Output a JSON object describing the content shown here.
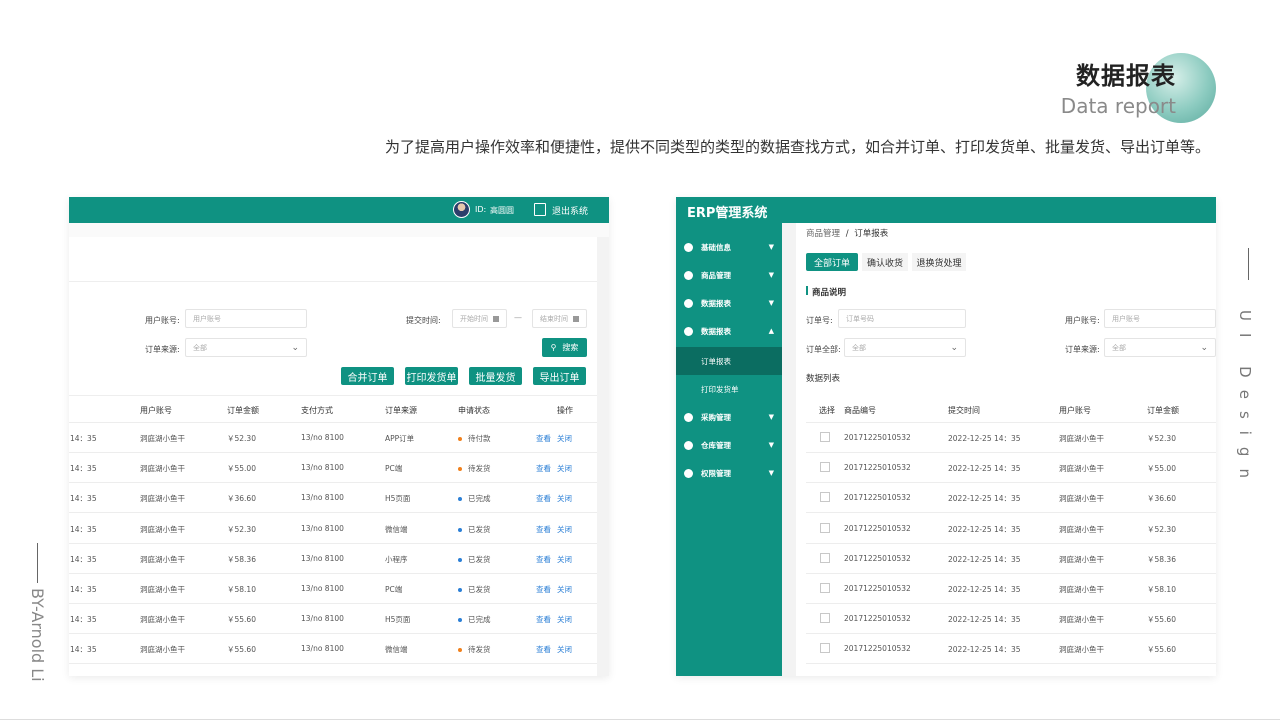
{
  "header": {
    "title_cn": "数据报表",
    "title_en": "Data report",
    "description": "为了提高用户操作效率和便捷性，提供不同类型的类型的数据查找方式，如合并订单、打印发货单、批量发货、导出订单等。"
  },
  "side": {
    "right_vertical": "UI Design",
    "left_vertical": "BY-Arnold Li"
  },
  "left_panel": {
    "user_id_label": "ID:",
    "user_name": "高圆圆",
    "logout_label": "退出系统",
    "filters": {
      "account_label": "用户账号:",
      "account_placeholder": "用户账号",
      "submit_time_label": "提交时间:",
      "start_placeholder": "开始时间",
      "range_sep": "—",
      "end_placeholder": "结束时间",
      "source_label": "订单来源:",
      "source_value": "全部",
      "search_label": "搜索"
    },
    "actions": [
      "合并订单",
      "打印发货单",
      "批量发货",
      "导出订单"
    ],
    "columns": [
      "用户账号",
      "订单金额",
      "支付方式",
      "订单来源",
      "申请状态",
      "操作"
    ],
    "rows": [
      {
        "time": "14：35",
        "account": "洞庭湖小鱼干",
        "amount": "￥52.30",
        "pay": "13/no 8100",
        "source": "APP订单",
        "status": "待付款",
        "status_color": "#f0801c"
      },
      {
        "time": "14：35",
        "account": "洞庭湖小鱼干",
        "amount": "￥55.00",
        "pay": "13/no 8100",
        "source": "PC端",
        "status": "待发货",
        "status_color": "#f0801c"
      },
      {
        "time": "14：35",
        "account": "洞庭湖小鱼干",
        "amount": "￥36.60",
        "pay": "13/no 8100",
        "source": "H5页面",
        "status": "已完成",
        "status_color": "#2b7fd6"
      },
      {
        "time": "14：35",
        "account": "洞庭湖小鱼干",
        "amount": "￥52.30",
        "pay": "13/no 8100",
        "source": "微信端",
        "status": "已发货",
        "status_color": "#2b7fd6"
      },
      {
        "time": "14：35",
        "account": "洞庭湖小鱼干",
        "amount": "￥58.36",
        "pay": "13/no 8100",
        "source": "小程序",
        "status": "已发货",
        "status_color": "#2b7fd6"
      },
      {
        "time": "14：35",
        "account": "洞庭湖小鱼干",
        "amount": "￥58.10",
        "pay": "13/no 8100",
        "source": "PC端",
        "status": "已发货",
        "status_color": "#2b7fd6"
      },
      {
        "time": "14：35",
        "account": "洞庭湖小鱼干",
        "amount": "￥55.60",
        "pay": "13/no 8100",
        "source": "H5页面",
        "status": "已完成",
        "status_color": "#2b7fd6"
      },
      {
        "time": "14：35",
        "account": "洞庭湖小鱼干",
        "amount": "￥55.60",
        "pay": "13/no 8100",
        "source": "微信端",
        "status": "待发货",
        "status_color": "#f0801c"
      }
    ],
    "view_label": "查看",
    "close_label": "关闭"
  },
  "right_panel": {
    "app_title": "ERP管理系统",
    "menu": [
      "基础信息",
      "商品管理",
      "数据报表",
      "数据报表",
      "采购管理",
      "仓库管理",
      "权限管理"
    ],
    "submenu": [
      "订单报表",
      "打印发货单"
    ],
    "breadcrumb": {
      "parent": "商品管理",
      "sep": "/",
      "current": "订单报表"
    },
    "tabs": [
      "全部订单",
      "确认收货",
      "退换货处理"
    ],
    "section_title": "商品说明",
    "filters": {
      "order_no_label": "订单号:",
      "order_no_placeholder": "订单号码",
      "account_label": "用户账号:",
      "account_placeholder": "用户账号",
      "all_label": "订单全部:",
      "all_value": "全部",
      "source_label": "订单来源:",
      "source_value": "全部"
    },
    "list_title": "数据列表",
    "columns": [
      "选择",
      "商品编号",
      "提交时间",
      "用户账号",
      "订单金额"
    ],
    "rows": [
      {
        "code": "20171225010532",
        "time": "2022-12-25 14：35",
        "account": "洞庭湖小鱼干",
        "amount": "￥52.30"
      },
      {
        "code": "20171225010532",
        "time": "2022-12-25 14：35",
        "account": "洞庭湖小鱼干",
        "amount": "￥55.00"
      },
      {
        "code": "20171225010532",
        "time": "2022-12-25 14：35",
        "account": "洞庭湖小鱼干",
        "amount": "￥36.60"
      },
      {
        "code": "20171225010532",
        "time": "2022-12-25 14：35",
        "account": "洞庭湖小鱼干",
        "amount": "￥52.30"
      },
      {
        "code": "20171225010532",
        "time": "2022-12-25 14：35",
        "account": "洞庭湖小鱼干",
        "amount": "￥58.36"
      },
      {
        "code": "20171225010532",
        "time": "2022-12-25 14：35",
        "account": "洞庭湖小鱼干",
        "amount": "￥58.10"
      },
      {
        "code": "20171225010532",
        "time": "2022-12-25 14：35",
        "account": "洞庭湖小鱼干",
        "amount": "￥55.60"
      },
      {
        "code": "20171225010532",
        "time": "2022-12-25 14：35",
        "account": "洞庭湖小鱼干",
        "amount": "￥55.60"
      }
    ]
  },
  "colors": {
    "accent": "#0f9282",
    "link": "#2b7fd6",
    "pending": "#f0801c"
  }
}
